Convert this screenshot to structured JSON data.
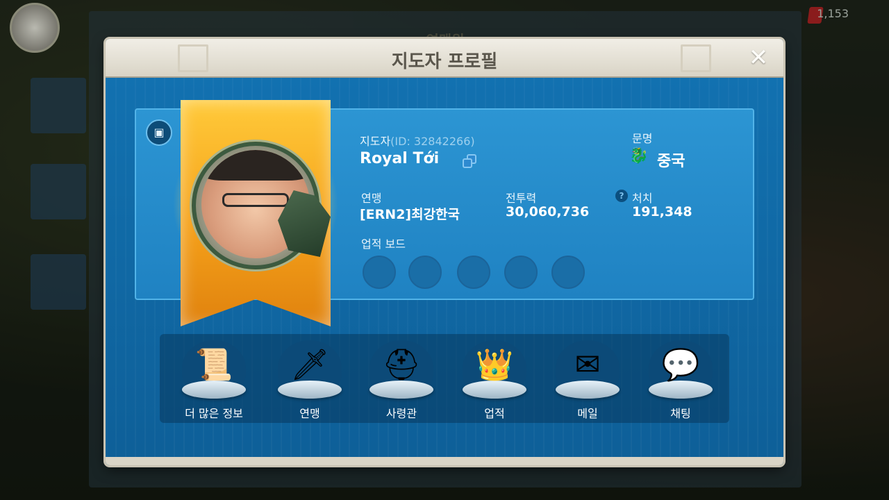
{
  "background": {
    "panel_title": "연맹원",
    "gems": "1,153"
  },
  "dialog": {
    "title": "지도자 프로필",
    "close_label": "✕"
  },
  "profile": {
    "leader_label": "지도자",
    "id_text": "(ID: 32842266)",
    "name": "Royal Tới",
    "civilization_label": "문명",
    "civilization_value": "중국",
    "alliance_label": "연맹",
    "alliance_value": "[ERN2]최강한국",
    "power_label": "전투력",
    "power_value": "30,060,736",
    "kills_label": "처치",
    "kills_value": "191,348",
    "achievement_board_label": "업적 보드",
    "help_glyph": "?"
  },
  "actions": [
    {
      "label": "더 많은 정보",
      "icon": "scroll-icon",
      "glyph": "📜"
    },
    {
      "label": "연맹",
      "icon": "sword-icon",
      "glyph": "🗡"
    },
    {
      "label": "사령관",
      "icon": "helmet-icon",
      "glyph": "⛑"
    },
    {
      "label": "업적",
      "icon": "crown-icon",
      "glyph": "👑"
    },
    {
      "label": "메일",
      "icon": "mail-icon",
      "glyph": "✉"
    },
    {
      "label": "채팅",
      "icon": "chat-icon",
      "glyph": "💬"
    }
  ],
  "colors": {
    "dialog_blue": "#0f6aa6",
    "card_blue": "#2c95d3",
    "banner_gold": "#f5a11a",
    "title_bar": "#e8e4d9"
  }
}
